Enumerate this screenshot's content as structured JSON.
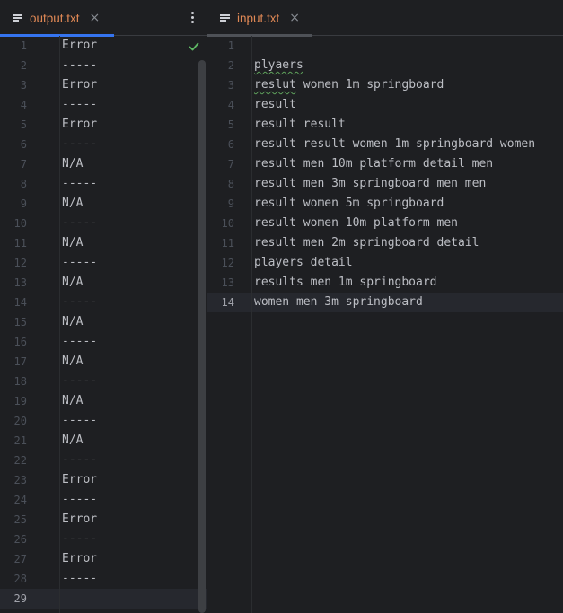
{
  "left_editor": {
    "tab": {
      "label": "output.txt",
      "close": "×"
    },
    "current_line": 29,
    "lines": [
      {
        "n": "1",
        "text": "Error"
      },
      {
        "n": "2",
        "text": "-----"
      },
      {
        "n": "3",
        "text": "Error"
      },
      {
        "n": "4",
        "text": "-----"
      },
      {
        "n": "5",
        "text": "Error"
      },
      {
        "n": "6",
        "text": "-----"
      },
      {
        "n": "7",
        "text": "N/A"
      },
      {
        "n": "8",
        "text": "-----"
      },
      {
        "n": "9",
        "text": "N/A"
      },
      {
        "n": "10",
        "text": "-----"
      },
      {
        "n": "11",
        "text": "N/A"
      },
      {
        "n": "12",
        "text": "-----"
      },
      {
        "n": "13",
        "text": "N/A"
      },
      {
        "n": "14",
        "text": "-----"
      },
      {
        "n": "15",
        "text": "N/A"
      },
      {
        "n": "16",
        "text": "-----"
      },
      {
        "n": "17",
        "text": "N/A"
      },
      {
        "n": "18",
        "text": "-----"
      },
      {
        "n": "19",
        "text": "N/A"
      },
      {
        "n": "20",
        "text": "-----"
      },
      {
        "n": "21",
        "text": "N/A"
      },
      {
        "n": "22",
        "text": "-----"
      },
      {
        "n": "23",
        "text": "Error"
      },
      {
        "n": "24",
        "text": "-----"
      },
      {
        "n": "25",
        "text": "Error"
      },
      {
        "n": "26",
        "text": "-----"
      },
      {
        "n": "27",
        "text": "Error"
      },
      {
        "n": "28",
        "text": "-----"
      },
      {
        "n": "29",
        "text": ""
      }
    ]
  },
  "right_editor": {
    "tab": {
      "label": "input.txt",
      "close": "×"
    },
    "current_line": 14,
    "lines": [
      {
        "n": "1",
        "text": ""
      },
      {
        "n": "2",
        "text": "plyaers"
      },
      {
        "n": "3",
        "text": "reslut women 1m springboard"
      },
      {
        "n": "4",
        "text": "result"
      },
      {
        "n": "5",
        "text": "result result"
      },
      {
        "n": "6",
        "text": "result result women 1m springboard women"
      },
      {
        "n": "7",
        "text": "result men 10m platform detail men"
      },
      {
        "n": "8",
        "text": "result men 3m springboard men men"
      },
      {
        "n": "9",
        "text": "result women 5m springboard"
      },
      {
        "n": "10",
        "text": "result women 10m platform men"
      },
      {
        "n": "11",
        "text": "result men 2m springboard detail"
      },
      {
        "n": "12",
        "text": "players detail"
      },
      {
        "n": "13",
        "text": "results men 1m springboard"
      },
      {
        "n": "14",
        "text": "women men 3m springboard"
      }
    ]
  },
  "colors": {
    "accent": "#3574f0",
    "tab_label": "#e08855",
    "check": "#5fb865",
    "background": "#1e1f22"
  },
  "icons": [
    "file-lines-icon",
    "close-icon",
    "more-vertical-icon",
    "check-icon"
  ]
}
